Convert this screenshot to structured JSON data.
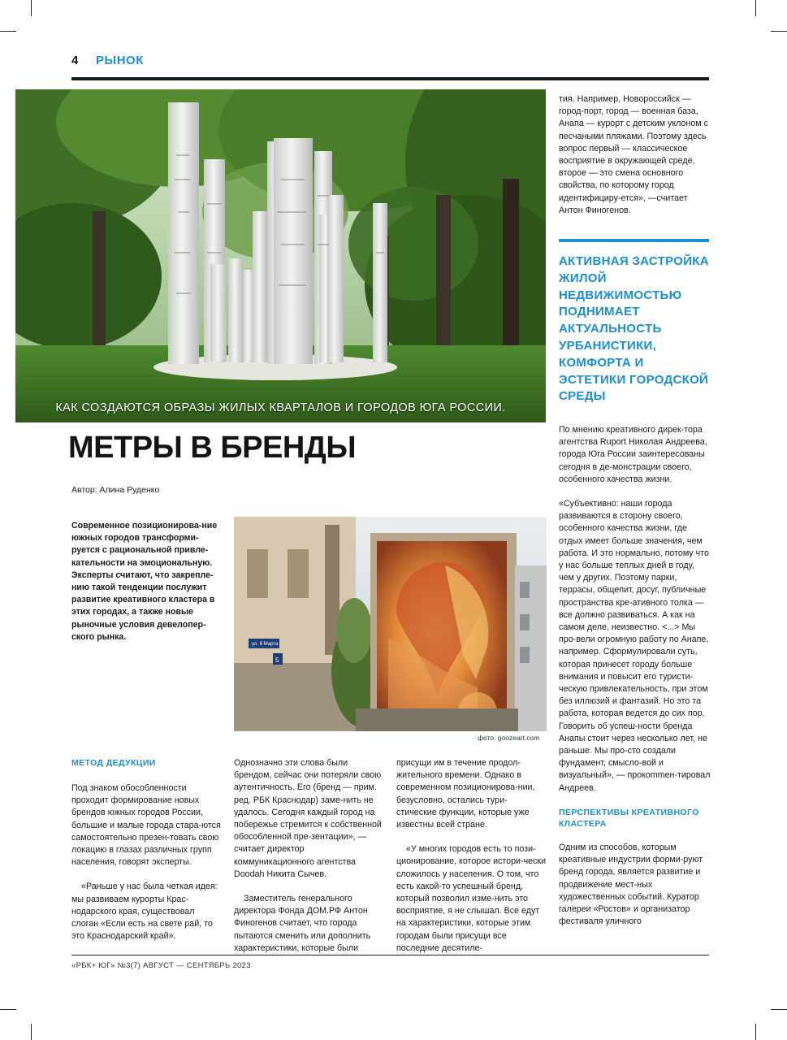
{
  "header": {
    "page_number": "4",
    "section": "РЫНОК"
  },
  "hero": {
    "caption": "КАК СОЗДАЮТСЯ ОБРАЗЫ ЖИЛЫХ КВАРТАЛОВ И ГОРОДОВ ЮГА РОССИИ."
  },
  "article": {
    "headline": "МЕТРЫ В БРЕНДЫ",
    "byline": "Автор: Алина Руденко",
    "lead": "Современное позиционирова-ние южных городов трансформи-руется с рациональной привле-кательности на эмоциональную. Эксперты считают, что закрепле-нию такой тенденции послужит развитие креативного кластера в этих городах, а также новые рыночные условия девелопер-ского рынка.",
    "photo_credit": "фото: goozeart.com",
    "col1": {
      "subhead": "МЕТОД ДЕДУКЦИИ",
      "p1": "Под знаком обособленности проходит формирование новых брендов южных городов России, большие и малые города стара-ются самостоятельно презен-товать свою локацию в глазах различных групп населения, говорят эксперты.",
      "p2": "«Раньше у нас была четкая идея: мы развиваем курорты Крас-нодарского края, существовал слоган «Если есть на свете рай, то это Краснодарский край»."
    },
    "col2": {
      "p1": "Однозначно эти слова были брендом, сейчас они потеряли свою аутентичность. Его (бренд — прим. ред. РБК Краснодар) заме-нить не удалось. Сегодня каждый город на побережье стремится к собственной обособленной пре-зентации», — считает директор коммуникационного агентства Doodah Никита Сычев.",
      "p2": "Заместитель генерального директора Фонда ДОМ.РФ Антон Финогенов считает, что города пытаются сменить или дополнить характеристики, которые были"
    },
    "col3": {
      "p1": "присущи им в течение продол-жительного времени. Однако в современном позиционирова-нии, безусловно, остались тури-стические функции, которые уже известны всей стране.",
      "p2": "«У многих городов есть то пози-ционирование, которое истори-чески сложилось у населения. О том, что есть какой-то успешный бренд, который позволил изме-нить это восприятие, я не слышал. Все едут на характеристики, которые этим городам были присущи все последние десятиле-"
    },
    "right_top": "тия. Например, Новороссийск — город-порт, город — военная база, Анапа — курорт с детским уклоном с песчаными пляжами. Поэтому здесь вопрос первый — классическое восприятие в окружающей среде, второе — это смена основного свойства, по которому город идентифициру-ется», —считает Антон Финогенов.",
    "pull_quote": "АКТИВНАЯ ЗАСТРОЙКА ЖИЛОЙ НЕДВИЖИМОСТЬЮ ПОДНИМАЕТ АКТУАЛЬНОСТЬ УРБАНИСТИКИ, КОМФОРТА И ЭСТЕТИКИ ГОРОДСКОЙ СРЕДЫ",
    "right_body": {
      "p1": "По мнению креативного дирек-тора агентства Ruport Николая Андреева, города Юга России заинтересованы сегодня в де-монстрации своего, особенного качества жизни.",
      "p2": "«Субъективно: наши города развиваются в сторону своего, особенного качества жизни, где отдых имеет больше значения, чем работа. И это нормально, потому что у нас больше теплых дней в году, чем у других. Поэтому парки, террасы, общепит, досуг, публичные пространства кре-ативного толка — все должно развиваться. А как на самом деле, неизвестно. <...> Мы про-вели огромную работу по Анапе, например. Сформулировали суть, которая принесет городу больше внимания и повысит его туристи-ческую привлекательность, при этом без иллюзий и фантазий. Но это та работа, которая ведется до сих пор. Говорить об успеш-ности бренда Анапы стоит через несколько лет, не раньше. Мы про-сто создали фундамент, смысло-вой и визуальный», — прокommен-тировал Андреев.",
      "subhead": "ПЕРСПЕКТИВЫ КРЕАТИВНОГО КЛАСТЕРА",
      "p3": "Одним из способов, которым креативные индустрии форми-руют бренд города, является развитие и продвижение мест-ных художественных событий. Куратор галереи «Ростов» и организатор фестиваля уличного"
    }
  },
  "mural": {
    "street_sign": "ул. 8 Марта",
    "house_number": "5"
  },
  "footer": {
    "text": "«РБК+ ЮГ» №3(7) АВГУСТ — СЕНТЯБРЬ 2023"
  }
}
